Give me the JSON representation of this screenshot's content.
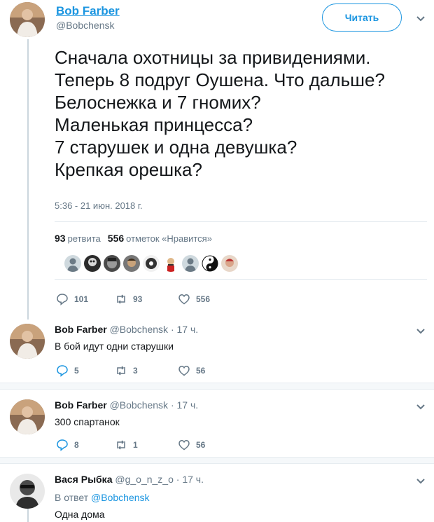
{
  "main_tweet": {
    "author_name": "Bob Farber",
    "author_handle": "@Bobchensk",
    "follow_label": "Читать",
    "text_lines": [
      "Сначала охотницы за привидениями.",
      "Теперь 8 подруг Оушена. Что дальше?",
      "Белоснежка и 7 гномих?",
      "Маленькая принцесса?",
      "7 старушек и одна девушка?",
      "Крепкая орешка?"
    ],
    "timestamp": "5:36 - 21 июн. 2018 г.",
    "retweets_count": "93",
    "retweets_label": "ретвита",
    "likes_count": "556",
    "likes_label": "отметок «Нравится»",
    "liker_avatars": [
      "liker-avatar-1",
      "liker-avatar-2",
      "liker-avatar-3",
      "liker-avatar-4",
      "liker-avatar-5",
      "liker-avatar-6",
      "liker-avatar-7",
      "liker-avatar-8",
      "liker-avatar-9"
    ],
    "replies": "101",
    "retweets": "93",
    "likes": "556"
  },
  "replies": [
    {
      "author_name": "Bob Farber",
      "author_handle": "@Bobchensk",
      "time": "· 17 ч.",
      "text": "В бой идут одни старушки",
      "replies": "5",
      "retweets": "3",
      "likes": "56"
    },
    {
      "author_name": "Bob Farber",
      "author_handle": "@Bobchensk",
      "time": "· 17 ч.",
      "text": "300 спартанок",
      "replies": "8",
      "retweets": "1",
      "likes": "56"
    },
    {
      "author_name": "Вася Рыбка",
      "author_handle": "@g_o_n_z_o",
      "time": "· 17 ч.",
      "reply_to_prefix": "В ответ",
      "reply_to_handle": "@Bobchensk",
      "text": "Одна дома"
    }
  ],
  "colors": {
    "accent": "#1b95e0",
    "secondary_text": "#657786",
    "divider": "#e1e8ed"
  }
}
